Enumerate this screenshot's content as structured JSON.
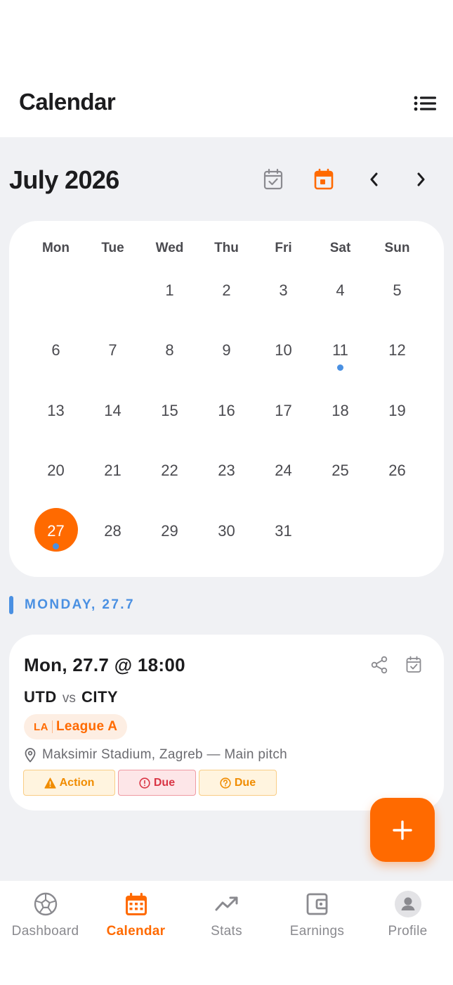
{
  "header": {
    "title": "Calendar",
    "menu_icon": "list-icon"
  },
  "calendar": {
    "month_title": "July 2026",
    "weekdays": [
      "Mon",
      "Tue",
      "Wed",
      "Thu",
      "Fri",
      "Sat",
      "Sun"
    ],
    "days": [
      "",
      "",
      "1",
      "2",
      "3",
      "4",
      "5",
      "6",
      "7",
      "8",
      "9",
      "10",
      "11",
      "12",
      "13",
      "14",
      "15",
      "16",
      "17",
      "18",
      "19",
      "20",
      "21",
      "22",
      "23",
      "24",
      "25",
      "26",
      "27",
      "28",
      "29",
      "30",
      "31",
      "",
      ""
    ],
    "selected_day": "27",
    "event_days": [
      "11",
      "27"
    ],
    "accent_color": "#ff6a00",
    "event_dot_color": "#4a90e2"
  },
  "section": {
    "label": "MONDAY, 27.7"
  },
  "match": {
    "datetime": "Mon, 27.7 @ 18:00",
    "home": "UTD",
    "vs": "vs",
    "away": "CITY",
    "league_abbr": "LA",
    "league_name": "League A",
    "venue": "Maksimir Stadium, Zagreb — Main pitch",
    "badges": [
      {
        "label": "Action",
        "icon": "warning-icon",
        "color": "#f08c00"
      },
      {
        "label": "Due",
        "icon": "alert-circle-icon",
        "color": "#d93545"
      },
      {
        "label": "Due",
        "icon": "question-circle-icon",
        "color": "#f08c00"
      }
    ]
  },
  "nav": {
    "items": [
      {
        "label": "Dashboard",
        "icon": "soccer-ball-icon"
      },
      {
        "label": "Calendar",
        "icon": "calendar-icon"
      },
      {
        "label": "Stats",
        "icon": "trending-up-icon"
      },
      {
        "label": "Earnings",
        "icon": "wallet-icon"
      },
      {
        "label": "Profile",
        "icon": "user-icon"
      }
    ],
    "active": "Calendar"
  }
}
